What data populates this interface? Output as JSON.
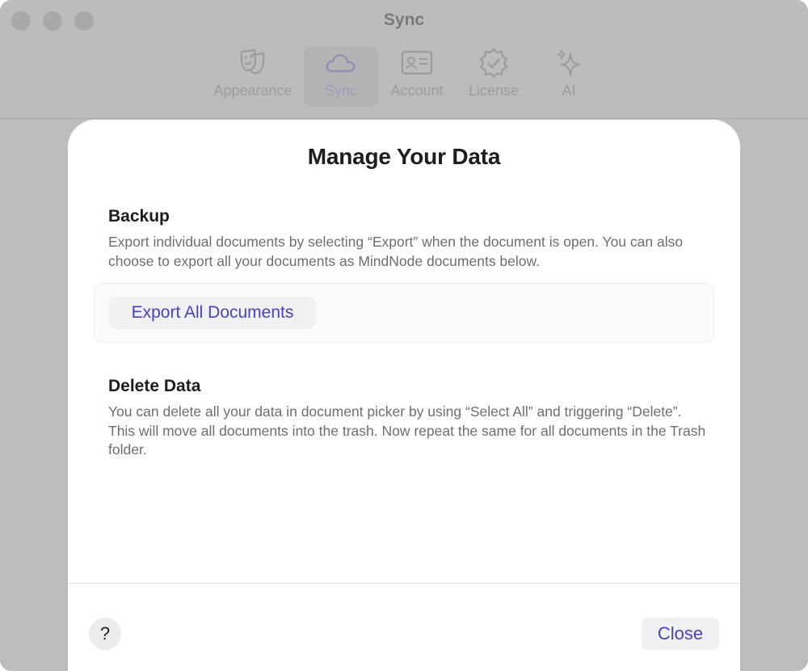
{
  "window": {
    "title": "Sync"
  },
  "toolbar": {
    "tabs": [
      {
        "label": "Appearance",
        "icon": "theater-masks-icon"
      },
      {
        "label": "Sync",
        "icon": "cloud-icon",
        "selected": true
      },
      {
        "label": "Account",
        "icon": "id-card-icon"
      },
      {
        "label": "License",
        "icon": "verified-badge-icon"
      },
      {
        "label": "AI",
        "icon": "sparkles-icon"
      }
    ]
  },
  "sheet": {
    "title": "Manage Your Data",
    "backup": {
      "heading": "Backup",
      "description": "Export individual documents by selecting “Export” when the document is open. You can also choose to export all your documents as MindNode documents below.",
      "export_button": "Export All Documents"
    },
    "delete": {
      "heading": "Delete Data",
      "description": "You can delete all your data in document picker by using “Select All” and triggering “Delete”. This will move all documents into the trash. Now repeat the same for all documents in the Trash folder."
    },
    "help_label": "?",
    "close_label": "Close"
  },
  "colors": {
    "accent": "#4a42b8",
    "dimmed_background": "#bdbdbd",
    "heading_text": "#1d1d1d",
    "body_text": "#6e6e6e"
  }
}
